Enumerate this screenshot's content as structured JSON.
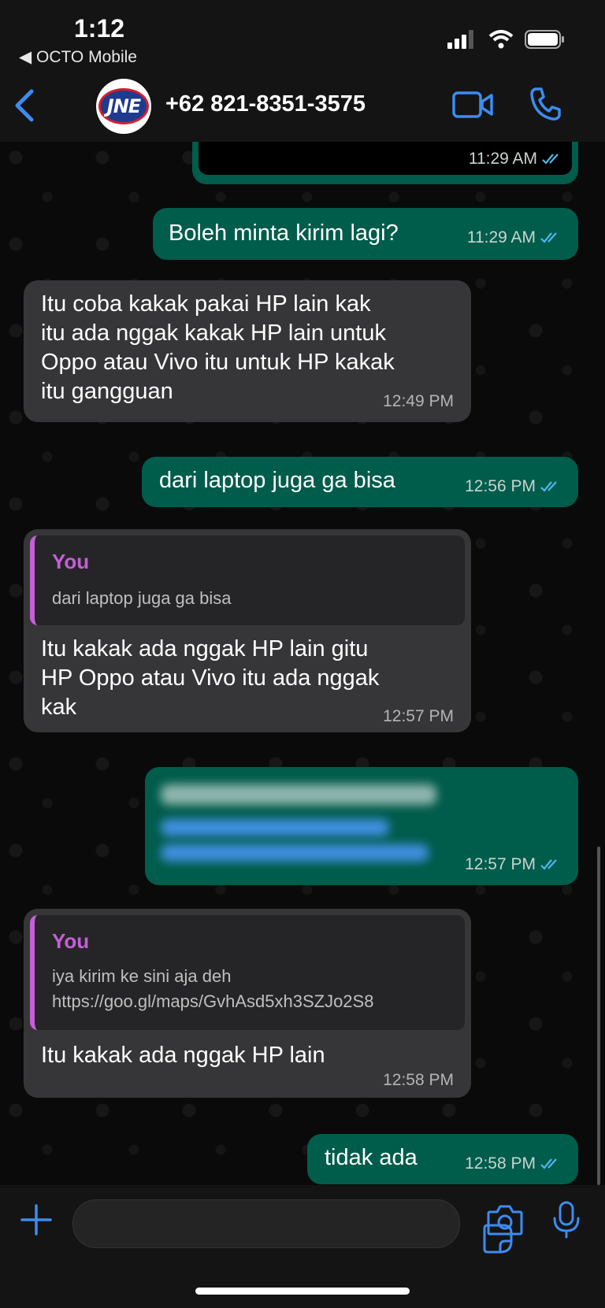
{
  "status": {
    "time": "1:12",
    "back_app": "◀ OCTO Mobile"
  },
  "header": {
    "contact": "+62 821-8351-3575",
    "avatar_text": "JNE"
  },
  "messages": [
    {
      "dir": "out",
      "text": "",
      "time": "11:29 AM"
    },
    {
      "dir": "out",
      "text": "Boleh minta kirim lagi?",
      "time": "11:29 AM"
    },
    {
      "dir": "in",
      "text": "Itu coba kakak pakai HP lain  kak\nitu ada nggak kakak HP lain untuk\nOppo atau Vivo  itu untuk HP kakak\nitu gangguan",
      "time": "12:49 PM"
    },
    {
      "dir": "out",
      "text": "dari laptop juga ga bisa",
      "time": "12:56 PM"
    },
    {
      "dir": "in",
      "quote_name": "You",
      "quote_text": "dari laptop juga ga bisa",
      "text": "Itu kakak ada nggak HP lain gitu\nHP Oppo atau Vivo itu ada nggak\nkak",
      "time": "12:57 PM"
    },
    {
      "dir": "out",
      "text": "",
      "time": "12:57 PM"
    },
    {
      "dir": "in",
      "quote_name": "You",
      "quote_text": "iya kirim ke sini aja deh\nhttps://goo.gl/maps/GvhAsd5xh3SZJo2S8",
      "text": "Itu kakak ada nggak HP lain",
      "time": "12:58 PM"
    },
    {
      "dir": "out",
      "text": "tidak ada",
      "time": "12:58 PM"
    }
  ],
  "composer": {
    "placeholder": ""
  },
  "colors": {
    "outgoing": "#005c4b",
    "incoming": "#363638",
    "accent": "#3d8cf0",
    "quote_name": "#c45fd6"
  }
}
